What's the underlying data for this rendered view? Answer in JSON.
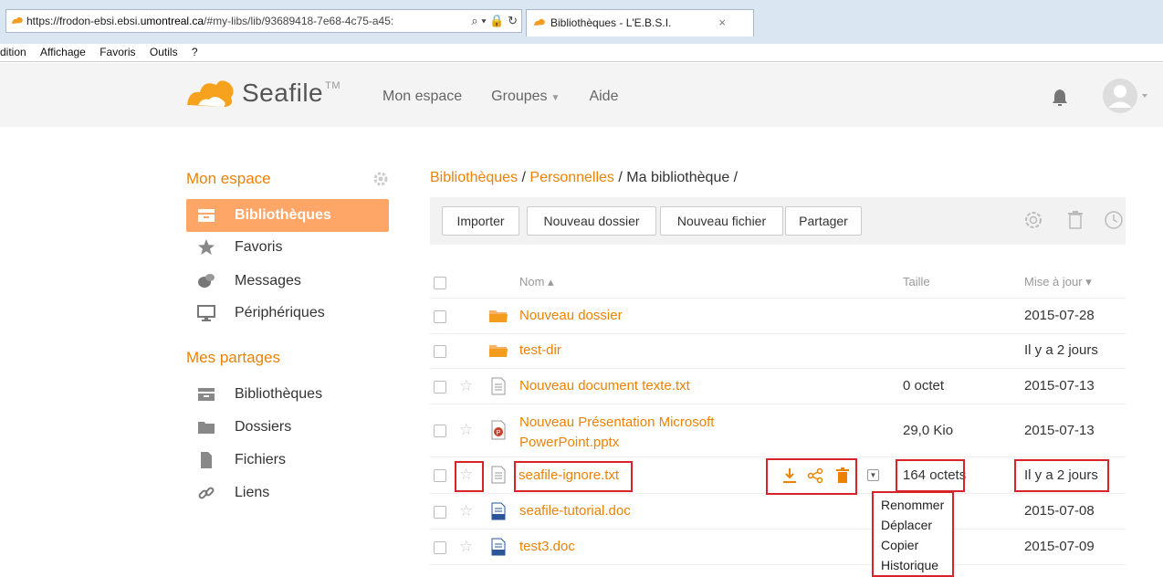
{
  "browser": {
    "url_prefix": "https://frodon-ebsi.ebsi.",
    "url_host": "umontreal.ca",
    "url_rest": "/#my-libs/lib/93689418-7e68-4c75-a45:",
    "tab_title": "Bibliothèques - L'E.B.S.I.",
    "tab_close": "×",
    "menu": [
      "dition",
      "Affichage",
      "Favoris",
      "Outils",
      "?"
    ]
  },
  "header": {
    "logo_text": "Seafile",
    "logo_tm": "TM",
    "nav": [
      "Mon espace",
      "Groupes",
      "Aide"
    ]
  },
  "sidebar": {
    "section1_title": "Mon espace",
    "section1_items": [
      {
        "label": "Bibliothèques",
        "icon": "library-icon"
      },
      {
        "label": "Favoris",
        "icon": "star-icon"
      },
      {
        "label": "Messages",
        "icon": "messages-icon"
      },
      {
        "label": "Périphériques",
        "icon": "monitor-icon"
      }
    ],
    "section2_title": "Mes partages",
    "section2_items": [
      {
        "label": "Bibliothèques",
        "icon": "library-icon"
      },
      {
        "label": "Dossiers",
        "icon": "folder-icon"
      },
      {
        "label": "Fichiers",
        "icon": "file-icon"
      },
      {
        "label": "Liens",
        "icon": "link-icon"
      }
    ]
  },
  "breadcrumb": {
    "part1": "Bibliothèques",
    "sep1": " / ",
    "part2": "Personnelles",
    "sep2": " / ",
    "part3": "Ma bibliothèque /"
  },
  "toolbar": {
    "buttons": [
      "Importer",
      "Nouveau dossier",
      "Nouveau fichier",
      "Partager"
    ]
  },
  "table": {
    "col_name": "Nom ▴",
    "col_size": "Taille",
    "col_date": "Mise à jour ▾",
    "rows": [
      {
        "name": "Nouveau dossier",
        "size": "",
        "date": "2015-07-28",
        "type": "folder"
      },
      {
        "name": "test-dir",
        "size": "",
        "date": "Il y a 2 jours",
        "type": "folder"
      },
      {
        "name": "Nouveau document texte.txt",
        "size": "0 octet",
        "date": "2015-07-13",
        "type": "txt"
      },
      {
        "name": "Nouveau Présentation Microsoft PowerPoint.pptx",
        "name_line1": "Nouveau Présentation Microsoft",
        "name_line2": "PowerPoint.pptx",
        "size": "29,0 Kio",
        "date": "2015-07-13",
        "type": "pptx"
      },
      {
        "name": "seafile-ignore.txt",
        "size": "164 octets",
        "date": "Il y a 2 jours",
        "type": "txt"
      },
      {
        "name": "seafile-tutorial.doc",
        "size": "",
        "date": "2015-07-08",
        "type": "doc"
      },
      {
        "name": "test3.doc",
        "size": "",
        "date": "2015-07-09",
        "type": "doc"
      }
    ]
  },
  "dropdown": [
    "Renommer",
    "Déplacer",
    "Copier",
    "Historique"
  ],
  "colors": {
    "accent": "#eb8205",
    "active_bg": "#fea667",
    "highlight": "#d9232a"
  }
}
